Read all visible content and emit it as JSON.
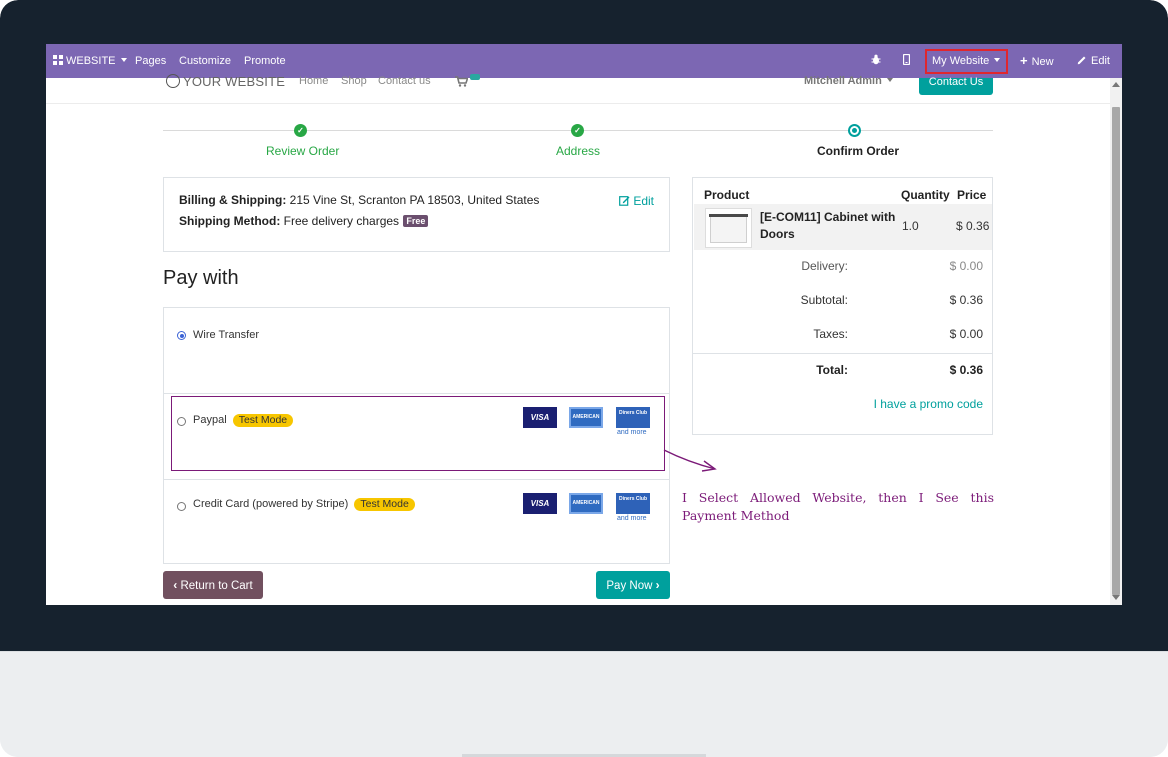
{
  "topbar": {
    "website_menu": "WEBSITE",
    "pages": "Pages",
    "customize": "Customize",
    "promote": "Promote",
    "my_website": "My Website",
    "new": "New",
    "edit": "Edit"
  },
  "site_header": {
    "logo": "YOUR WEBSITE",
    "nav": [
      "Home",
      "Shop",
      "Contact us"
    ],
    "user": "Mitchell Admin",
    "contact_button": "Contact Us"
  },
  "steps": [
    {
      "label": "Review Order",
      "state": "done"
    },
    {
      "label": "Address",
      "state": "done"
    },
    {
      "label": "Confirm Order",
      "state": "current"
    }
  ],
  "billing": {
    "billing_label": "Billing & Shipping:",
    "billing_value": "215 Vine St, Scranton PA 18503, United States",
    "shipping_label": "Shipping Method:",
    "shipping_value": "Free delivery charges",
    "free_badge": "Free",
    "edit": "Edit"
  },
  "payment": {
    "title": "Pay with",
    "methods": [
      {
        "label": "Wire Transfer",
        "selected": true,
        "test_badge": ""
      },
      {
        "label": "Paypal",
        "selected": false,
        "test_badge": "Test Mode"
      },
      {
        "label": "Credit Card (powered by Stripe)",
        "selected": false,
        "test_badge": "Test Mode"
      }
    ],
    "card_icons": [
      "VISA",
      "AMERICAN EXPRESS",
      "Diners Club"
    ],
    "and_more": "and more"
  },
  "annotation": "I Select Allowed Website, then I See this Payment Method",
  "buttons": {
    "return": "Return to Cart",
    "pay_now": "Pay Now"
  },
  "summary": {
    "headers": [
      "Product",
      "Quantity",
      "Price"
    ],
    "product": {
      "name": "[E-COM11] Cabinet with Doors",
      "qty": "1.0",
      "price": "$ 0.36"
    },
    "delivery_label": "Delivery:",
    "delivery": "$ 0.00",
    "subtotal_label": "Subtotal:",
    "subtotal": "$ 0.36",
    "taxes_label": "Taxes:",
    "taxes": "$ 0.00",
    "total_label": "Total:",
    "total": "$ 0.36",
    "promo": "I have a promo code"
  },
  "colors": {
    "topbar": "#7c67b3",
    "accent": "#00a09d",
    "highlight": "#7b1a78",
    "success": "#28a745"
  }
}
